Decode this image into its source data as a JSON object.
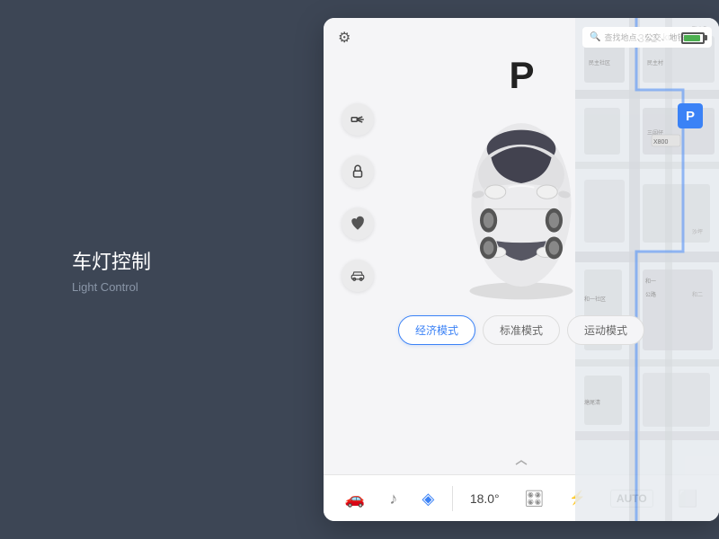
{
  "left": {
    "title_cn": "车灯控制",
    "title_en": "Light Control"
  },
  "topbar": {
    "range_km": "352",
    "range_unit": "km"
  },
  "car": {
    "park_label": "P",
    "park_badge": "P"
  },
  "controls": [
    {
      "id": "headlights",
      "icon": "headlight"
    },
    {
      "id": "lock",
      "icon": "lock"
    },
    {
      "id": "heart",
      "icon": "heart"
    },
    {
      "id": "car-small",
      "icon": "car"
    }
  ],
  "modes": [
    {
      "id": "eco",
      "label": "经济模式",
      "active": true
    },
    {
      "id": "standard",
      "label": "标准模式",
      "active": false
    },
    {
      "id": "sport",
      "label": "运动模式",
      "active": false
    }
  ],
  "map": {
    "search_placeholder": "查找地点、公交、地铁"
  },
  "bottom_nav": [
    {
      "id": "car",
      "icon": "🚗",
      "active": false
    },
    {
      "id": "music",
      "icon": "🎵",
      "active": false
    },
    {
      "id": "nav",
      "icon": "📍",
      "active": true
    },
    {
      "id": "temp",
      "value": "18.0°",
      "active": false
    },
    {
      "id": "steering",
      "icon": "🎛",
      "active": false
    },
    {
      "id": "ac",
      "icon": "❄",
      "active": false
    },
    {
      "id": "auto",
      "label": "AUTO",
      "active": false
    },
    {
      "id": "screen",
      "icon": "🖥",
      "active": false
    }
  ]
}
